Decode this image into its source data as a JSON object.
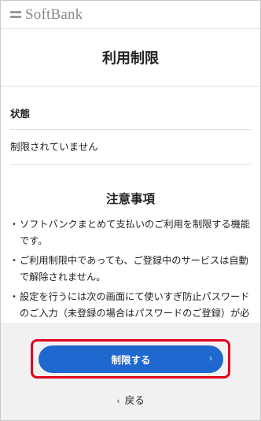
{
  "header": {
    "brand": "SoftBank",
    "logo_icon": "softbank-lines-icon"
  },
  "page": {
    "title": "利用制限"
  },
  "status": {
    "label": "状態",
    "value": "制限されていません"
  },
  "notes": {
    "title": "注意事項",
    "items": [
      "ソフトバンクまとめて支払いのご利用を制限する機能です。",
      "ご利用制限中であっても、ご登録中のサービスは自動で解除されません。",
      "設定を行うには次の画面にて使いすぎ防止パスワードのご入力（未登録の場合はパスワードのご登録）が必要です。"
    ]
  },
  "actions": {
    "limit_button_label": "制限する",
    "limit_button_chevron": "›",
    "back_label": "戻る",
    "back_chevron": "‹"
  },
  "colors": {
    "accent_button": "#1f68cf",
    "highlight_border": "#e0001b",
    "footer_bg": "#f1f1f1"
  }
}
